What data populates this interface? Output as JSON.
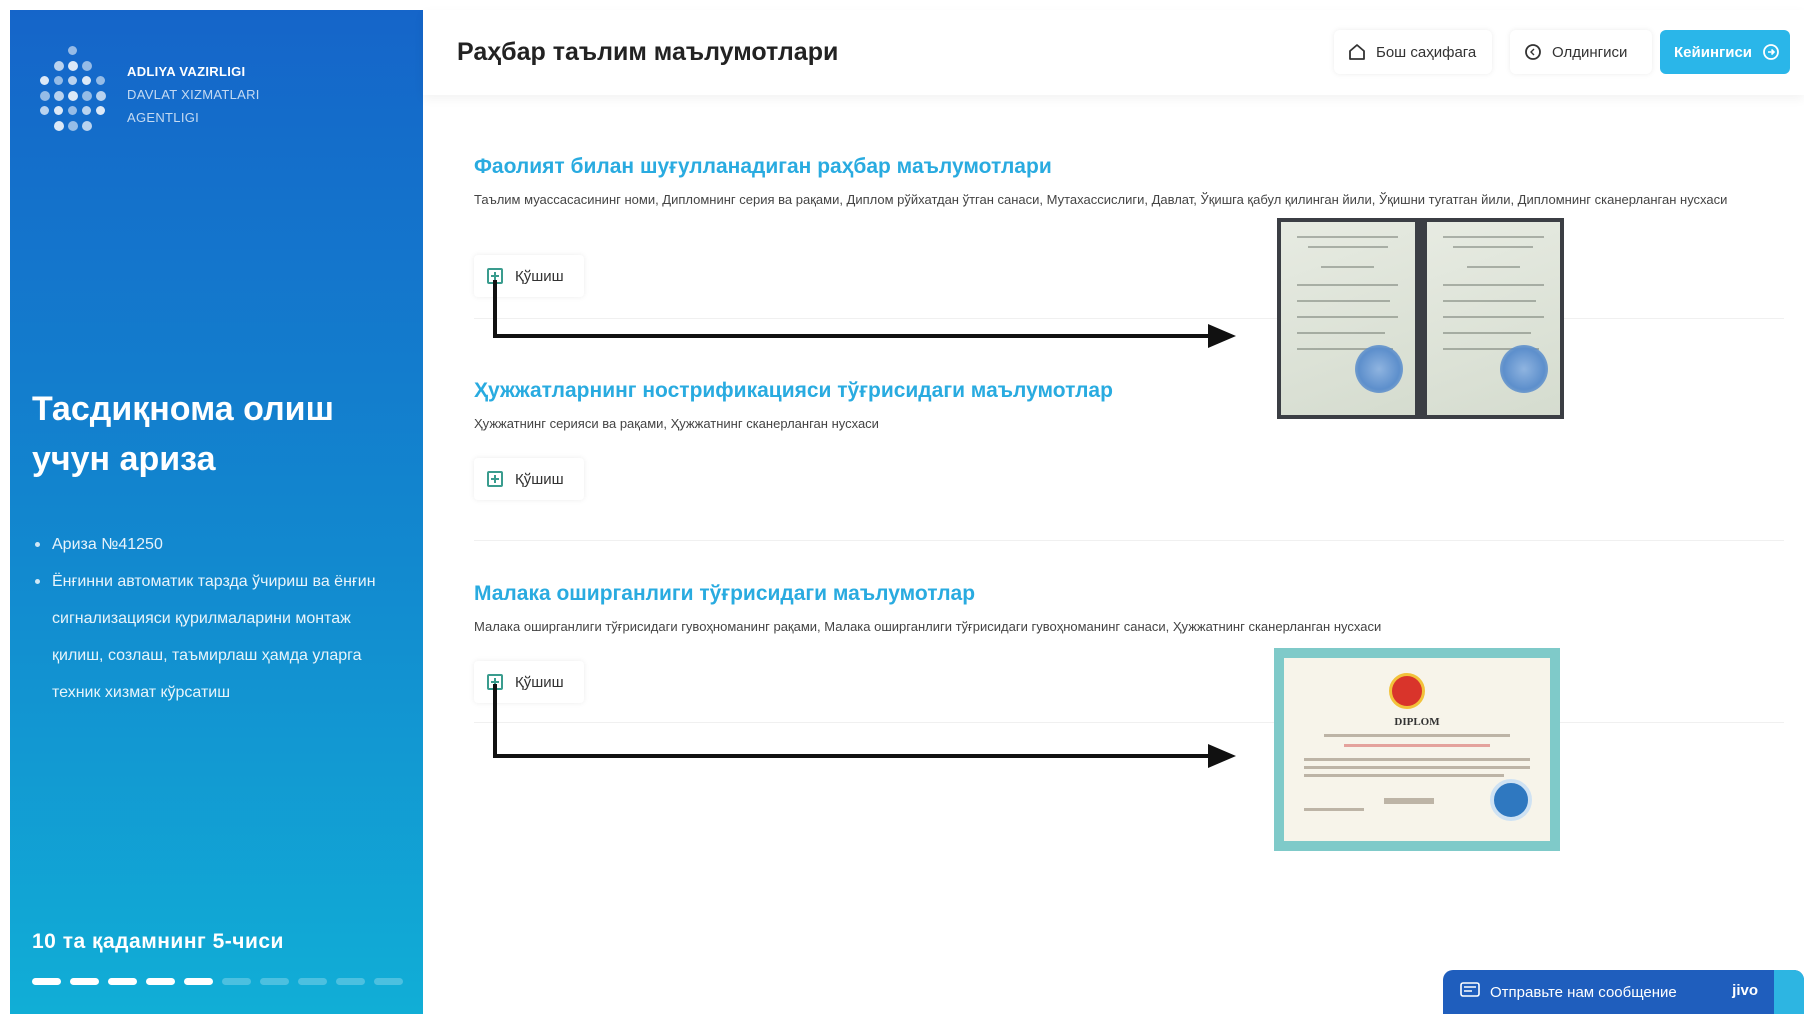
{
  "sidebar": {
    "org_line1": "ADLIYA VAZIRLIGI",
    "org_line2": "DAVLAT XIZMATLARI",
    "org_line3": "AGENTLIGI",
    "title": "Тасдиқнома олиш учун ариза",
    "items": [
      "Ариза №41250",
      "Ёнғинни автоматик тарзда ўчириш ва ёнғин сигнализацияси қурилмаларини монтаж қилиш, созлаш, таъмирлаш ҳамда уларга техник хизмат кўрсатиш"
    ],
    "step_text": "10 та қадамнинг 5-чиси",
    "progress": {
      "current": 5,
      "total": 10
    }
  },
  "header": {
    "title": "Раҳбар таълим маълумотлари",
    "home_label": "Бош саҳифага",
    "prev_label": "Олдингиси",
    "next_label": "Кейингиси"
  },
  "sections": [
    {
      "title": "Фаолият билан шуғулланадиган раҳбар маълумотлари",
      "description": "Таълим муассасасининг номи, Дипломнинг серия ва рақами, Диплом рўйхатдан ўтган санаси, Мутахассислиги, Давлат, Ўқишга қабул қилинган йили, Ўқишни тугатган йили, Дипломнинг сканерланган нусхаси",
      "add_label": "Қўшиш"
    },
    {
      "title": "Ҳужжатларнинг нострификацияси тўғрисидаги маълумотлар",
      "description": "Ҳужжатнинг серияси ва рақами, Ҳужжатнинг сканерланган нусхаси",
      "add_label": "Қўшиш"
    },
    {
      "title": "Малака оширганлиги тўғрисидаги маълумотлар",
      "description": "Малака оширганлиги тўғрисидаги гувоҳноманинг рақами, Малака оширганлиги тўғрисидаги гувоҳноманинг санаси, Ҳужжатнинг сканерланган нусхаси",
      "add_label": "Қўшиш"
    }
  ],
  "certificate": {
    "title": "DIPLOM"
  },
  "chat": {
    "label": "Отправьте нам сообщение",
    "brand": "jivo"
  },
  "colors": {
    "sidebar_top": "#1565c9",
    "sidebar_bottom": "#11aed6",
    "accent": "#29abe0",
    "next_button": "#2ab6e9",
    "chat": "#1f5ebd"
  },
  "icons": {
    "home": "home-icon",
    "prev": "circle-icon",
    "next": "arrow-right-circle-icon",
    "add": "plus-square-icon",
    "chat": "message-icon"
  }
}
